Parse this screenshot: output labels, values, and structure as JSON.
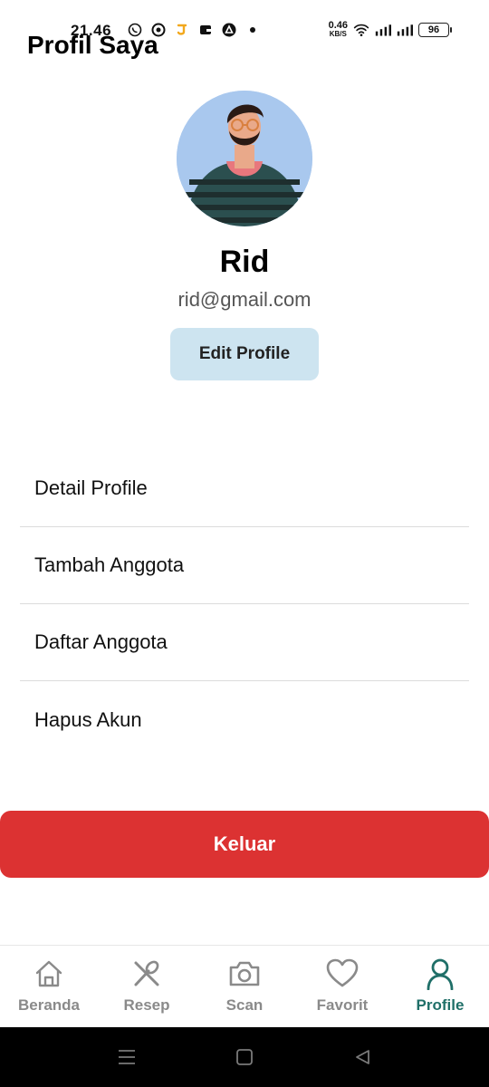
{
  "status_bar": {
    "time": "21.46",
    "speed_value": "0.46",
    "speed_unit": "KB/S",
    "battery": "96",
    "left_icons": [
      "whatsapp-icon",
      "target-icon",
      "j-app-icon",
      "wallet-icon",
      "triangle-app-icon",
      "dot-icon"
    ],
    "right_icons": [
      "wifi-icon",
      "signal-icon",
      "signal-icon",
      "battery-icon"
    ]
  },
  "header": {
    "title": "Profil Saya"
  },
  "profile": {
    "avatar_icon": "avatar-illustration",
    "name": "Rid",
    "email": "rid@gmail.com",
    "edit_label": "Edit Profile"
  },
  "menu": {
    "items": [
      {
        "label": "Detail Profile"
      },
      {
        "label": "Tambah Anggota"
      },
      {
        "label": "Daftar Anggota"
      },
      {
        "label": "Hapus Akun"
      }
    ]
  },
  "logout": {
    "label": "Keluar"
  },
  "bottom_nav": {
    "items": [
      {
        "label": "Beranda",
        "icon": "home-icon"
      },
      {
        "label": "Resep",
        "icon": "utensils-icon"
      },
      {
        "label": "Scan",
        "icon": "camera-icon"
      },
      {
        "label": "Favorit",
        "icon": "heart-icon"
      },
      {
        "label": "Profile",
        "icon": "user-icon",
        "active": true
      }
    ]
  },
  "system_nav": {
    "icons": [
      "menu-icon",
      "home-square-icon",
      "back-icon"
    ]
  },
  "colors": {
    "accent": "#1f6f68",
    "inactive": "#8a8a8a",
    "logout": "#dc3232",
    "edit_button": "#cde4f0",
    "avatar_bg": "#a9c8ee"
  }
}
